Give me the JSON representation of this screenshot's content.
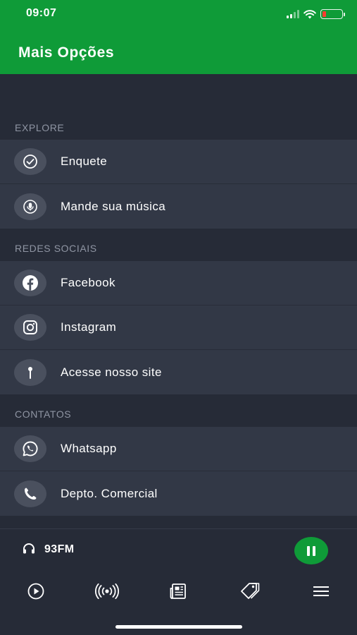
{
  "status_bar": {
    "time": "09:07"
  },
  "header": {
    "title": "Mais Opções",
    "background": "#0f9b38"
  },
  "sections": [
    {
      "title": "EXPLORE",
      "items": [
        {
          "label": "Enquete",
          "icon": "check-circle-icon"
        },
        {
          "label": "Mande sua música",
          "icon": "microphone-icon"
        }
      ]
    },
    {
      "title": "REDES SOCIAIS",
      "items": [
        {
          "label": "Facebook",
          "icon": "facebook-icon"
        },
        {
          "label": "Instagram",
          "icon": "instagram-icon"
        },
        {
          "label": "Acesse nosso site",
          "icon": "pin-icon"
        }
      ]
    },
    {
      "title": "CONTATOS",
      "items": [
        {
          "label": "Whatsapp",
          "icon": "whatsapp-icon"
        },
        {
          "label": "Depto. Comercial",
          "icon": "phone-icon"
        }
      ]
    }
  ],
  "player": {
    "station": "93FM",
    "state": "playing",
    "accent": "#0f9b38"
  },
  "tabbar": {
    "tabs": [
      {
        "icon": "play-icon"
      },
      {
        "icon": "broadcast-icon"
      },
      {
        "icon": "news-icon"
      },
      {
        "icon": "tag-icon"
      },
      {
        "icon": "menu-icon"
      }
    ]
  }
}
